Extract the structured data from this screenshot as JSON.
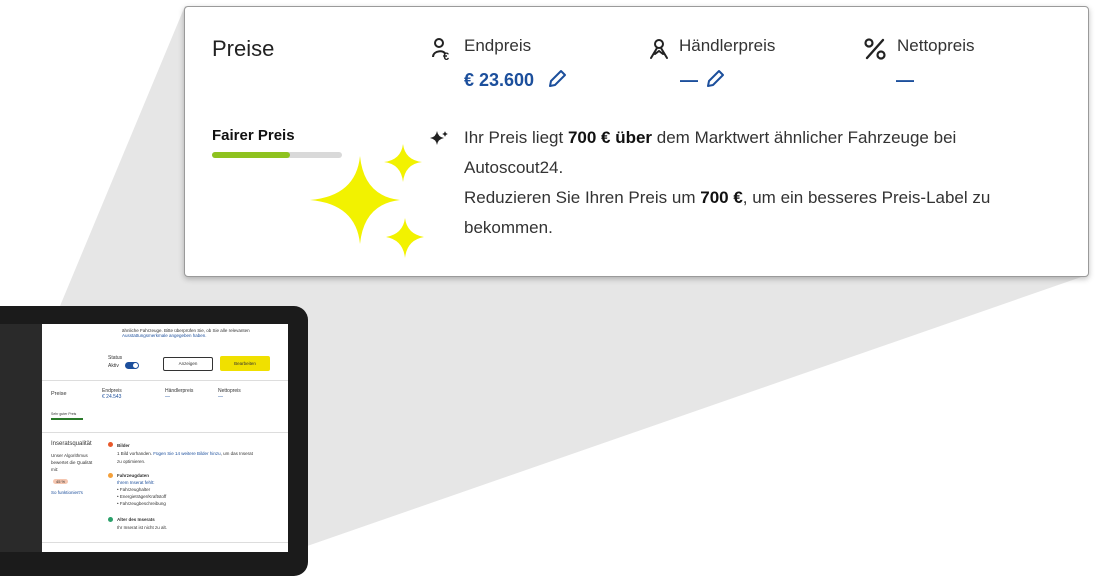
{
  "card": {
    "section_title": "Preise",
    "endpreis": {
      "label": "Endpreis",
      "value": "€ 23.600"
    },
    "haendlerpreis": {
      "label": "Händlerpreis",
      "value": "—"
    },
    "nettopreis": {
      "label": "Nettopreis",
      "value": "—"
    },
    "price_label": {
      "text": "Fairer Preis",
      "level": 0.6,
      "color": "#8ec21f"
    },
    "message": {
      "line1_pre": "Ihr Preis liegt ",
      "line1_bold": "700 € über",
      "line1_post": " dem Marktwert ähnlicher Fahrzeuge bei",
      "line2": "Autoscout24.",
      "line3_pre": "Reduzieren Sie Ihren Preis um ",
      "line3_bold": "700 €",
      "line3_post": ", um ein besseres Preis-Label zu",
      "line4": "bekommen."
    }
  },
  "screen": {
    "top_text1": "ähnliche Fahrzeuge. Bitte überprüfen Sie, ob Sie alle relevanten",
    "top_text2": "Ausstattungsmerkmale angegeben haben.",
    "status_label": "Status",
    "status_value": "Aktiv",
    "btn_view": "Anzeigen",
    "btn_edit": "Bearbeiten",
    "preise_title": "Preise",
    "endpreis_label": "Endpreis",
    "endpreis_value": "€ 24.543",
    "haendlerpreis_label": "Händlerpreis",
    "haendlerpreis_value": "—",
    "nettopreis_label": "Nettopreis",
    "nettopreis_value": "—",
    "price_label": "Sehr guter Preis",
    "quality_title": "Inseratsqualität",
    "quality_desc1": "Unser Algorithmus",
    "quality_desc2": "bewertet die Qualität",
    "quality_desc3": "mit:",
    "quality_score": "45 %",
    "quality_link": "So funktioniert's",
    "bilder_title": "Bilder",
    "bilder_pre": "1 Bild vorhanden. ",
    "bilder_link": "Fügen Sie 14 weitere Bilder hinzu",
    "bilder_post": ", um das Inserat",
    "bilder_line2": "zu optimieren.",
    "fahrzeugdaten_title": "Fahrzeugdaten",
    "fahrzeugdaten_link": "Ihrem Inserat fehlt:",
    "missing": [
      "Fahrzeughalter",
      "Energieträger/Kraftstoff",
      "Fahrzeugbeschreibung"
    ],
    "alter_title": "Alter des Inserats",
    "alter_text": "Ihr Inserat ist nicht zu alt."
  },
  "colors": {
    "accent_blue": "#1c4f9c",
    "sparkle_yellow": "#f2f200",
    "button_yellow": "#f0e000",
    "bar_green": "#8ec21f"
  }
}
